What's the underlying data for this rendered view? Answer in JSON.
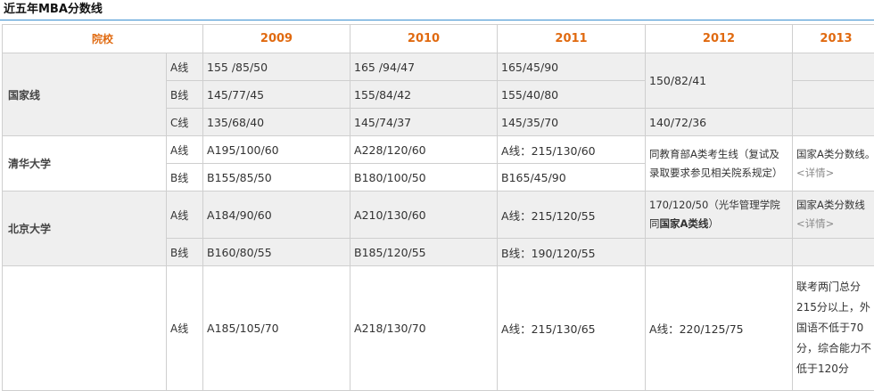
{
  "title": "近五年MBA分数线",
  "headers": {
    "school": "院校",
    "years": [
      "2009",
      "2010",
      "2011",
      "2012",
      "2013"
    ]
  },
  "guojia": {
    "name": "国家线",
    "rows": [
      {
        "type": "A线",
        "y2009": "155 /85/50",
        "y2010": "165 /94/47",
        "y2011": "165/45/90"
      },
      {
        "type": "B线",
        "y2009": "145/77/45",
        "y2010": "155/84/42",
        "y2011": "155/40/80"
      },
      {
        "type": "C线",
        "y2009": "135/68/40",
        "y2010": "145/74/37",
        "y2011": "145/35/70",
        "y2012": "140/72/36"
      }
    ],
    "y2012_ab": "150/82/41"
  },
  "qinghua": {
    "name": "清华大学",
    "rows": [
      {
        "type": "A线",
        "y2009": "A195/100/60",
        "y2010": "A228/120/60",
        "y2011": "A线：215/130/60"
      },
      {
        "type": "B线",
        "y2009": "B155/85/50",
        "y2010": "B180/100/50",
        "y2011": "B165/45/90"
      }
    ],
    "y2012": "同教育部A类考生线（复试及录取要求参见相关院系规定）",
    "y2013_main": "国家A类分数线。",
    "y2013_link": "<详情>"
  },
  "beida": {
    "name": "北京大学",
    "rows": [
      {
        "type": "A线",
        "y2009": "A184/90/60",
        "y2010": "A210/130/60",
        "y2011": "A线：215/120/55"
      },
      {
        "type": "B线",
        "y2009": "B160/80/55",
        "y2010": "B185/120/55",
        "y2011": "B线：190/120/55"
      }
    ],
    "y2012_pre": "170/120/50（光华管理学院同",
    "y2012_bold": "国家A类线",
    "y2012_post": "）",
    "y2013_main": "国家A类分数线",
    "y2013_link": "<详情>"
  },
  "fourth": {
    "rows": [
      {
        "type": "A线",
        "y2009": "A185/105/70",
        "y2010": "A218/130/70",
        "y2011": "A线：215/130/65",
        "y2012": "A线：220/125/75"
      }
    ],
    "y2013": "联考两门总分215分以上，外国语不低于70分，综合能力不低于120分"
  }
}
